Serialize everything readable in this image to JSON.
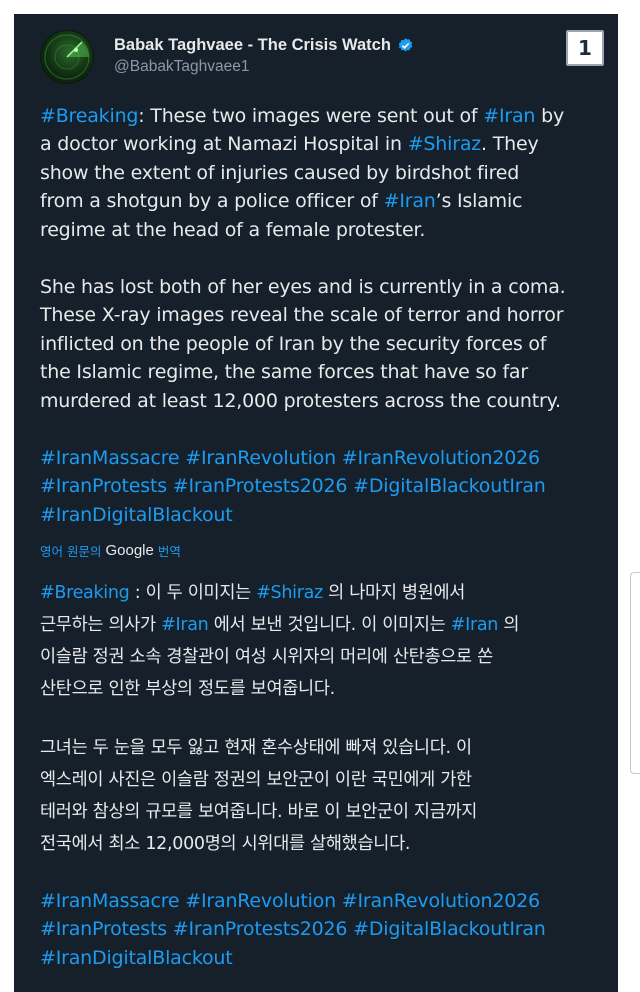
{
  "post": {
    "display_name": "Babak Taghvaee - The Crisis Watch",
    "handle": "@BabakTaghvaee1",
    "image_counter": "1",
    "icons": {
      "avatar": "radar-avatar",
      "badge": "verified-badge-icon"
    },
    "colors": {
      "background": "#15202b",
      "text": "#e7e9ea",
      "link": "#1d9bf0",
      "muted": "#8b98a5"
    },
    "english": {
      "paragraph1": [
        [
          {
            "t": "#Breaking",
            "tag": true
          },
          {
            "t": ": These two images were sent out of "
          },
          {
            "t": "#Iran",
            "tag": true
          },
          {
            "t": " by"
          }
        ],
        [
          {
            "t": "a doctor working at Namazi Hospital in "
          },
          {
            "t": "#Shiraz",
            "tag": true
          },
          {
            "t": ". They"
          }
        ],
        [
          {
            "t": "show the extent of injuries caused by birdshot fired"
          }
        ],
        [
          {
            "t": "from a shotgun by a police officer of "
          },
          {
            "t": "#Iran",
            "tag": true
          },
          {
            "t": "’s Islamic"
          }
        ],
        [
          {
            "t": "regime at the head of a female protester."
          }
        ]
      ],
      "paragraph2": [
        [
          {
            "t": "She has lost both of her eyes and is currently in a coma."
          }
        ],
        [
          {
            "t": "These X-ray images reveal the scale of terror and horror"
          }
        ],
        [
          {
            "t": "inflicted on the people of Iran by the security forces of"
          }
        ],
        [
          {
            "t": "the Islamic regime, the same forces that have so far"
          }
        ],
        [
          {
            "t": "murdered at least 12,000 protesters across the country."
          }
        ]
      ],
      "hashtags": [
        [
          {
            "t": "#IranMassacre #IranRevolution #IranRevolution2026",
            "tag": true
          }
        ],
        [
          {
            "t": "#IranProtests #IranProtests2026 #DigitalBlackoutIran",
            "tag": true
          }
        ],
        [
          {
            "t": "#IranDigitalBlackout",
            "tag": true
          }
        ]
      ]
    },
    "translation": {
      "label": "영어 원문의",
      "provider": "Google",
      "action": "번역"
    },
    "korean": {
      "paragraph1": [
        [
          {
            "t": "#Breaking",
            "tag": true
          },
          {
            "t": " : 이 두 이미지는 "
          },
          {
            "t": "#Shiraz",
            "tag": true
          },
          {
            "t": " 의 나마지 병원에서"
          }
        ],
        [
          {
            "t": "근무하는 의사가 "
          },
          {
            "t": "#Iran",
            "tag": true
          },
          {
            "t": " 에서 보낸 것입니다. 이 이미지는 "
          },
          {
            "t": "#Iran",
            "tag": true
          },
          {
            "t": " 의"
          }
        ],
        [
          {
            "t": "이슬람 정권 소속 경찰관이 여성 시위자의 머리에 산탄총으로 쏜"
          }
        ],
        [
          {
            "t": "산탄으로 인한 부상의 정도를 보여줍니다."
          }
        ]
      ],
      "paragraph2": [
        [
          {
            "t": "그녀는 두 눈을 모두 잃고 현재 혼수상태에 빠져 있습니다. 이"
          }
        ],
        [
          {
            "t": "엑스레이 사진은 이슬람 정권의 보안군이 이란 국민에게 가한"
          }
        ],
        [
          {
            "t": "테러와 참상의 규모를 보여줍니다. 바로 이 보안군이 지금까지"
          }
        ],
        [
          {
            "t": "전국에서 최소 12,000명의 시위대를 살해했습니다."
          }
        ]
      ],
      "hashtags": [
        [
          {
            "t": "#IranMassacre #IranRevolution #IranRevolution2026",
            "tag": true
          }
        ],
        [
          {
            "t": "#IranProtests #IranProtests2026 #DigitalBlackoutIran",
            "tag": true
          }
        ],
        [
          {
            "t": "#IranDigitalBlackout",
            "tag": true
          }
        ]
      ]
    }
  }
}
